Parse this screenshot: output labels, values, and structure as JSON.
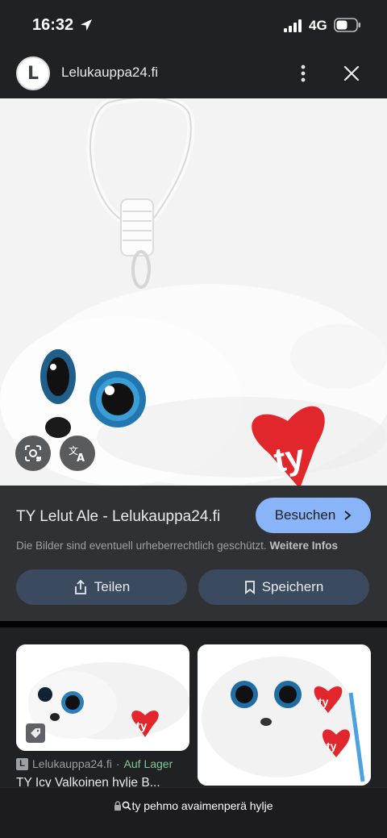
{
  "status": {
    "time": "16:32",
    "network": "4G"
  },
  "header": {
    "site_initial": "L",
    "site_name": "Lelukauppa24.fi"
  },
  "info": {
    "title": "TY Lelut Ale - Lelukauppa24.fi",
    "visit_label": "Besuchen",
    "notice": "Die Bilder sind eventuell urheberrechtlich geschützt.",
    "notice_link": "Weitere Infos",
    "share_label": "Teilen",
    "save_label": "Speichern"
  },
  "related": {
    "source_initial": "L",
    "source": "Lelukauppa24.fi",
    "separator": "·",
    "stock": "Auf Lager",
    "title": "TY Icy Valkoinen hylje B..."
  },
  "urlbar": {
    "query": "ty pehmo avaimenperä hylje"
  },
  "colors": {
    "accent": "#8ab4f8",
    "stock_green": "#81c995",
    "panel": "#303134",
    "background": "#202124"
  }
}
